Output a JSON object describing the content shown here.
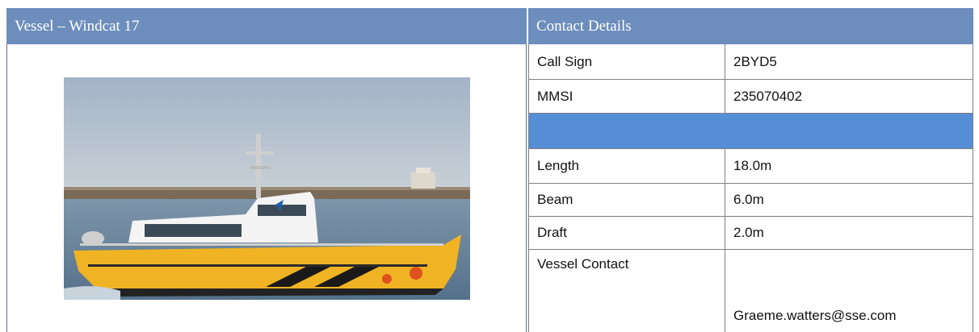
{
  "vessel": {
    "header": "Vessel – Windcat 17",
    "photo_name": "windcat-17-vessel-photo"
  },
  "contact": {
    "header": "Contact Details",
    "rows": [
      {
        "label": "Call Sign",
        "value": "2BYD5"
      },
      {
        "label": "MMSI",
        "value": "235070402"
      },
      {
        "label": "Length",
        "value": "18.0m"
      },
      {
        "label": "Beam",
        "value": "6.0m"
      },
      {
        "label": "Draft",
        "value": "2.0m"
      },
      {
        "label": "Vessel Contact",
        "value": "Graeme.watters@sse.com"
      }
    ]
  },
  "colors": {
    "header_bg": "#6d8ebc",
    "band_bg": "#558ed5"
  }
}
